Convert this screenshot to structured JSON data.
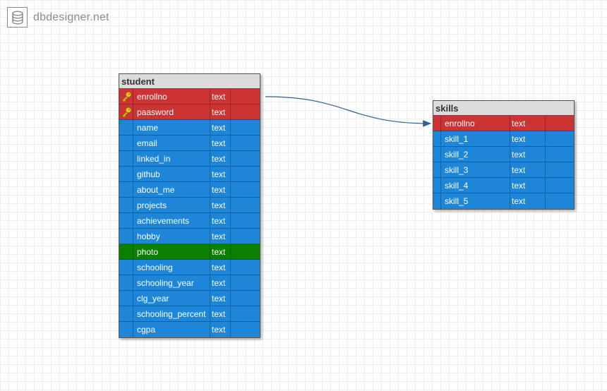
{
  "brand": {
    "name": "dbdesigner.net",
    "icon": "database-icon"
  },
  "tables": [
    {
      "id": "student",
      "name": "student",
      "columns": [
        {
          "name": "enrollno",
          "type": "text",
          "kind": "pk"
        },
        {
          "name": "paasword",
          "type": "text",
          "kind": "pk"
        },
        {
          "name": "name",
          "type": "text",
          "kind": "normal"
        },
        {
          "name": "email",
          "type": "text",
          "kind": "normal"
        },
        {
          "name": "linked_in",
          "type": "text",
          "kind": "normal"
        },
        {
          "name": "github",
          "type": "text",
          "kind": "normal"
        },
        {
          "name": "about_me",
          "type": "text",
          "kind": "normal"
        },
        {
          "name": "projects",
          "type": "text",
          "kind": "normal"
        },
        {
          "name": "achievements",
          "type": "text",
          "kind": "normal"
        },
        {
          "name": "hobby",
          "type": "text",
          "kind": "normal"
        },
        {
          "name": "photo",
          "type": "text",
          "kind": "special"
        },
        {
          "name": "schooling",
          "type": "text",
          "kind": "normal"
        },
        {
          "name": "schooling_year",
          "type": "text",
          "kind": "normal"
        },
        {
          "name": "clg_year",
          "type": "text",
          "kind": "normal"
        },
        {
          "name": "schooling_percent",
          "type": "text",
          "kind": "normal"
        },
        {
          "name": "cgpa",
          "type": "text",
          "kind": "normal"
        }
      ]
    },
    {
      "id": "skills",
      "name": "skills",
      "columns": [
        {
          "name": "enrollno",
          "type": "text",
          "kind": "fk"
        },
        {
          "name": "skill_1",
          "type": "text",
          "kind": "normal"
        },
        {
          "name": "skill_2",
          "type": "text",
          "kind": "normal"
        },
        {
          "name": "skill_3",
          "type": "text",
          "kind": "normal"
        },
        {
          "name": "skill_4",
          "type": "text",
          "kind": "normal"
        },
        {
          "name": "skill_5",
          "type": "text",
          "kind": "normal"
        }
      ]
    }
  ],
  "relations": [
    {
      "from_table": "student",
      "from_column": "enrollno",
      "to_table": "skills",
      "to_column": "enrollno"
    }
  ],
  "colors": {
    "pk_row": "#cc3333",
    "normal_row": "#1e86d8",
    "special_row": "#0b8000",
    "relation_line": "#2f5f96"
  }
}
